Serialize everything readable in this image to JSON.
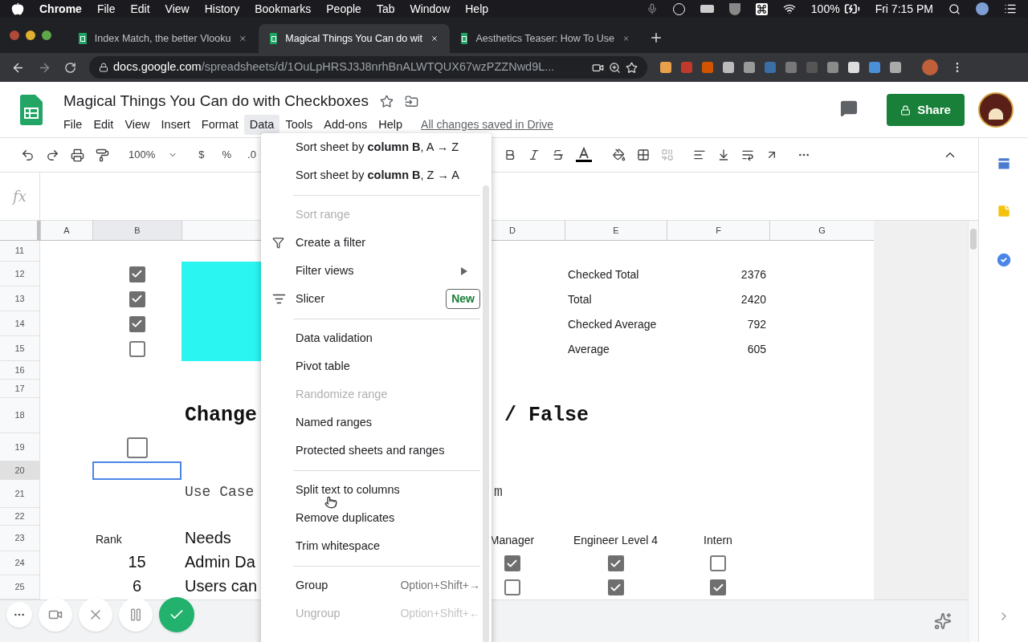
{
  "menubar": {
    "app": "Chrome",
    "items": [
      "File",
      "Edit",
      "View",
      "History",
      "Bookmarks",
      "People",
      "Tab",
      "Window",
      "Help"
    ],
    "battery": "100%",
    "clock": "Fri 7:15 PM"
  },
  "browser": {
    "tabs": [
      {
        "title": "Index Match, the better Vlooku",
        "selected": false
      },
      {
        "title": "Magical Things You Can do wit",
        "selected": true
      },
      {
        "title": "Aesthetics Teaser: How To Use",
        "selected": false
      }
    ],
    "url_host": "docs.google.com",
    "url_path": "/spreadsheets/d/1OuLpHRSJ3J8nrhBnALWTQUX67wzPZZNwd9L..."
  },
  "doc": {
    "title": "Magical Things You Can do with Checkboxes",
    "menus": [
      {
        "label": "File",
        "selected": false
      },
      {
        "label": "Edit",
        "selected": false
      },
      {
        "label": "View",
        "selected": false
      },
      {
        "label": "Insert",
        "selected": false
      },
      {
        "label": "Format",
        "selected": false
      },
      {
        "label": "Data",
        "selected": true
      },
      {
        "label": "Tools",
        "selected": false
      },
      {
        "label": "Add-ons",
        "selected": false
      },
      {
        "label": "Help",
        "selected": false
      }
    ],
    "save_status": "All changes saved in Drive",
    "share": "Share"
  },
  "toolbar": {
    "zoom": "100%",
    "currency": "$",
    "percent": "%",
    "decimal": ".0"
  },
  "formula_bar": {
    "fx": "fx"
  },
  "columns": [
    {
      "label": "A",
      "selected": false
    },
    {
      "label": "B",
      "selected": true
    },
    {
      "selected": false
    },
    {
      "label": "D",
      "selected": false
    },
    {
      "label": "E",
      "selected": false
    },
    {
      "label": "F",
      "selected": false
    },
    {
      "label": "G",
      "selected": false
    }
  ],
  "rows": [
    {
      "number": "11",
      "selected": false
    },
    {
      "number": "12",
      "selected": false,
      "b": {
        "kind": "checkbox",
        "checked": true
      },
      "c": {
        "kind": "fill"
      },
      "e": {
        "kind": "text",
        "text": "Checked Total"
      },
      "f": {
        "kind": "number",
        "text": "2376"
      }
    },
    {
      "number": "13",
      "selected": false,
      "b": {
        "kind": "checkbox",
        "checked": true
      },
      "c": {
        "kind": "fill"
      },
      "e": {
        "kind": "text",
        "text": "Total"
      },
      "f": {
        "kind": "number",
        "text": "2420"
      }
    },
    {
      "number": "14",
      "selected": false,
      "b": {
        "kind": "checkbox",
        "checked": true
      },
      "c": {
        "kind": "fill"
      },
      "e": {
        "kind": "text",
        "text": "Checked Average"
      },
      "f": {
        "kind": "number",
        "text": "792"
      }
    },
    {
      "number": "15",
      "selected": false,
      "b": {
        "kind": "checkbox",
        "checked": false
      },
      "c": {
        "kind": "fill"
      },
      "e": {
        "kind": "text",
        "text": "Average"
      },
      "f": {
        "kind": "number",
        "text": "605"
      }
    },
    {
      "number": "16",
      "selected": false
    },
    {
      "number": "17",
      "selected": false
    },
    {
      "number": "18",
      "selected": false,
      "c": {
        "kind": "heading",
        "text": "Change"
      },
      "d": {
        "kind": "heading",
        "text": "/ False"
      }
    },
    {
      "number": "19",
      "selected": false,
      "b": {
        "kind": "checkbox_large",
        "checked": false
      }
    },
    {
      "number": "20",
      "selected": true
    },
    {
      "number": "21",
      "selected": false,
      "c": {
        "kind": "mono",
        "text": "Use Case"
      },
      "d": {
        "kind": "mono",
        "text": "m"
      }
    },
    {
      "number": "22",
      "selected": false
    },
    {
      "number": "23",
      "selected": false,
      "b": {
        "kind": "text",
        "text": "Rank"
      },
      "c": {
        "kind": "large",
        "text": "Needs"
      },
      "d": {
        "kind": "header",
        "text": "Manager"
      },
      "e": {
        "kind": "header",
        "text": "Engineer Level 4"
      },
      "f": {
        "kind": "header",
        "text": "Intern"
      }
    },
    {
      "number": "24",
      "selected": false,
      "b": {
        "kind": "large_number",
        "text": "15"
      },
      "c": {
        "kind": "large",
        "text": "Admin Da"
      },
      "d": {
        "kind": "checkbox",
        "checked": true
      },
      "e": {
        "kind": "checkbox",
        "checked": true
      },
      "f": {
        "kind": "checkbox",
        "checked": false
      }
    },
    {
      "number": "25",
      "selected": false,
      "b": {
        "kind": "large_number",
        "text": "6"
      },
      "c": {
        "kind": "large",
        "text": "Users can"
      },
      "d": {
        "kind": "checkbox",
        "checked": false
      },
      "e": {
        "kind": "checkbox",
        "checked": true
      },
      "f": {
        "kind": "checkbox",
        "checked": true
      }
    }
  ],
  "data_menu": {
    "items": [
      {
        "kind": "item",
        "label": "Sort sheet by **column B**, A → Z",
        "disabled": false
      },
      {
        "kind": "item",
        "label": "Sort sheet by **column B**, Z → A",
        "disabled": false
      },
      {
        "kind": "separator"
      },
      {
        "kind": "item",
        "label": "Sort range",
        "disabled": true
      },
      {
        "kind": "filter",
        "label": "Create a filter",
        "disabled": false
      },
      {
        "kind": "submenu",
        "label": "Filter views",
        "disabled": false
      },
      {
        "kind": "slicer",
        "label": "Slicer",
        "disabled": false,
        "badge": "New"
      },
      {
        "kind": "separator"
      },
      {
        "kind": "item",
        "label": "Data validation",
        "disabled": false
      },
      {
        "kind": "item",
        "label": "Pivot table",
        "disabled": false
      },
      {
        "kind": "item",
        "label": "Randomize range",
        "disabled": true
      },
      {
        "kind": "item",
        "label": "Named ranges",
        "disabled": false
      },
      {
        "kind": "item",
        "label": "Protected sheets and ranges",
        "disabled": false
      },
      {
        "kind": "separator"
      },
      {
        "kind": "hovered",
        "label": "Split text to columns",
        "disabled": false
      },
      {
        "kind": "item",
        "label": "Remove duplicates",
        "disabled": false
      },
      {
        "kind": "item",
        "label": "Trim whitespace",
        "disabled": false
      },
      {
        "kind": "separator"
      },
      {
        "kind": "item",
        "label": "Group",
        "disabled": false,
        "shortcut": "Option+Shift+→"
      },
      {
        "kind": "item",
        "label": "Ungroup",
        "disabled": true,
        "shortcut": "Option+Shift+←"
      }
    ]
  }
}
